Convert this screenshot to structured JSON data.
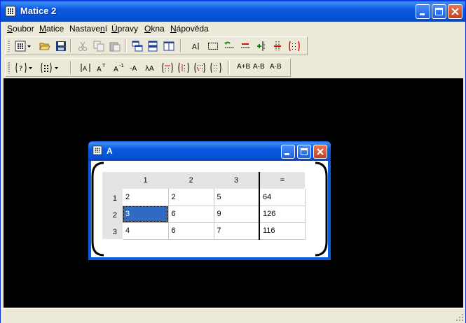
{
  "window": {
    "title": "Matice 2"
  },
  "menu": [
    {
      "label": "Soubor",
      "u": "S",
      "rest": "oubor"
    },
    {
      "label": "Matice",
      "u": "M",
      "rest": "atice"
    },
    {
      "label": "Nastavení",
      "pre": "Nastave",
      "u": "n",
      "rest": "í"
    },
    {
      "label": "Úpravy",
      "u": "Ú",
      "rest": "pravy"
    },
    {
      "label": "Okna",
      "u": "O",
      "rest": "kna"
    },
    {
      "label": "Nápověda",
      "u": "N",
      "rest": "ápověda"
    }
  ],
  "toolbar2_text": {
    "apb": "A+B",
    "amb": "A-B",
    "atb": "A·B"
  },
  "matrix_window": {
    "title": "A",
    "column_headers": [
      "1",
      "2",
      "3",
      "="
    ],
    "row_headers": [
      "1",
      "2",
      "3"
    ],
    "rows": [
      [
        "2",
        "2",
        "5",
        "64"
      ],
      [
        "3",
        "6",
        "9",
        "126"
      ],
      [
        "4",
        "6",
        "7",
        "116"
      ]
    ],
    "selected_cell": "row 2, column 1"
  }
}
